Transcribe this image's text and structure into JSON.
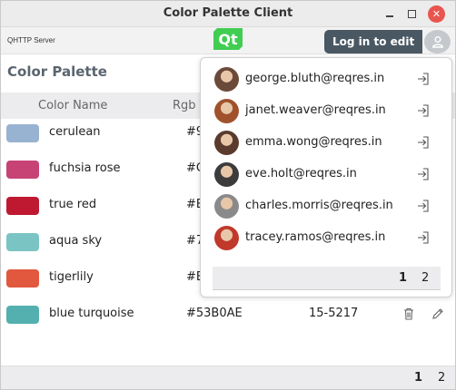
{
  "window": {
    "title": "Color Palette Client"
  },
  "header": {
    "server_label": "QHTTP Server",
    "logo_text": "Qt",
    "login_tooltip": "Log in to edit"
  },
  "section_title": "Color Palette",
  "table": {
    "columns": [
      "Color Name",
      "Rgb V"
    ],
    "rows": [
      {
        "name": "cerulean",
        "hex": "#9",
        "pantone": "",
        "color": "#98b2d1"
      },
      {
        "name": "fuchsia rose",
        "hex": "#C",
        "pantone": "",
        "color": "#c74375"
      },
      {
        "name": "true red",
        "hex": "#E",
        "pantone": "",
        "color": "#bf1932"
      },
      {
        "name": "aqua sky",
        "hex": "#7",
        "pantone": "",
        "color": "#7bc4c4"
      },
      {
        "name": "tigerlily",
        "hex": "#E",
        "pantone": "",
        "color": "#e2583e"
      },
      {
        "name": "blue turquoise",
        "hex": "#53B0AE",
        "pantone": "15-5217",
        "color": "#53b0ae"
      }
    ]
  },
  "pagination": {
    "pages": [
      "1",
      "2"
    ],
    "current": "1"
  },
  "users_popup": {
    "users": [
      {
        "email": "george.bluth@reqres.in",
        "avatar_color": "#6b4a3a"
      },
      {
        "email": "janet.weaver@reqres.in",
        "avatar_color": "#a0522d"
      },
      {
        "email": "emma.wong@reqres.in",
        "avatar_color": "#5a3b2e"
      },
      {
        "email": "eve.holt@reqres.in",
        "avatar_color": "#3c3c3c"
      },
      {
        "email": "charles.morris@reqres.in",
        "avatar_color": "#8a8a8a"
      },
      {
        "email": "tracey.ramos@reqres.in",
        "avatar_color": "#c0392b"
      }
    ],
    "pages": [
      "1",
      "2"
    ]
  }
}
